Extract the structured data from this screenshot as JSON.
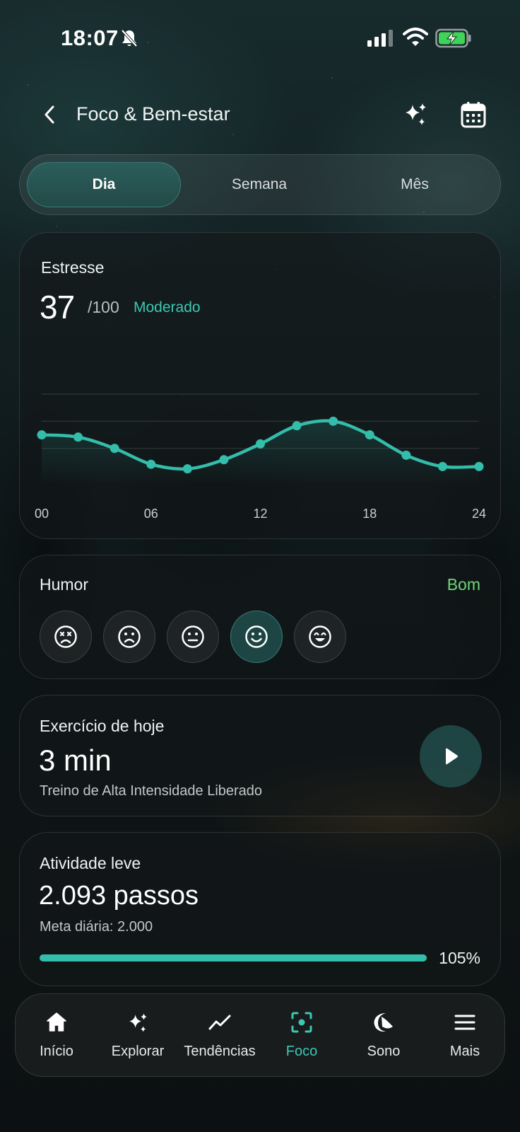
{
  "status_bar": {
    "time": "18:07"
  },
  "header": {
    "title": "Foco & Bem-estar"
  },
  "segments": [
    {
      "label": "Dia",
      "active": true
    },
    {
      "label": "Semana",
      "active": false
    },
    {
      "label": "Mês",
      "active": false
    }
  ],
  "stress": {
    "title": "Estresse",
    "value": "37",
    "max": "/100",
    "status": "Moderado"
  },
  "chart_data": {
    "type": "line",
    "x": [
      0,
      2,
      4,
      6,
      8,
      10,
      12,
      14,
      16,
      18,
      20,
      22,
      24
    ],
    "values": [
      42,
      41,
      36,
      29,
      27,
      31,
      38,
      46,
      48,
      42,
      33,
      28,
      28
    ],
    "xlim": [
      0,
      24
    ],
    "ylim": [
      0,
      100
    ],
    "x_ticks": [
      "00",
      "06",
      "12",
      "18",
      "24"
    ],
    "color": "#33bdaa"
  },
  "mood": {
    "title": "Humor",
    "status": "Bom",
    "options": [
      "very-sad-face-icon",
      "sad-face-icon",
      "neutral-face-icon",
      "smile-face-icon",
      "happy-face-icon"
    ],
    "selected_index": 3
  },
  "exercise": {
    "title": "Exercício de hoje",
    "value": "3 min",
    "subtitle": "Treino de Alta Intensidade Liberado"
  },
  "activity": {
    "title": "Atividade leve",
    "value": "2.093 passos",
    "subtitle": "Meta diária: 2.000",
    "progress_percent": 105,
    "progress_label": "105%"
  },
  "nav": [
    {
      "label": "Início",
      "icon": "home-icon"
    },
    {
      "label": "Explorar",
      "icon": "sparkle-icon"
    },
    {
      "label": "Tendências",
      "icon": "trend-icon"
    },
    {
      "label": "Foco",
      "icon": "focus-icon",
      "active": true
    },
    {
      "label": "Sono",
      "icon": "moon-icon"
    },
    {
      "label": "Mais",
      "icon": "menu-icon"
    }
  ],
  "colors": {
    "accent": "#33bdaa",
    "good": "#6fd67a"
  }
}
